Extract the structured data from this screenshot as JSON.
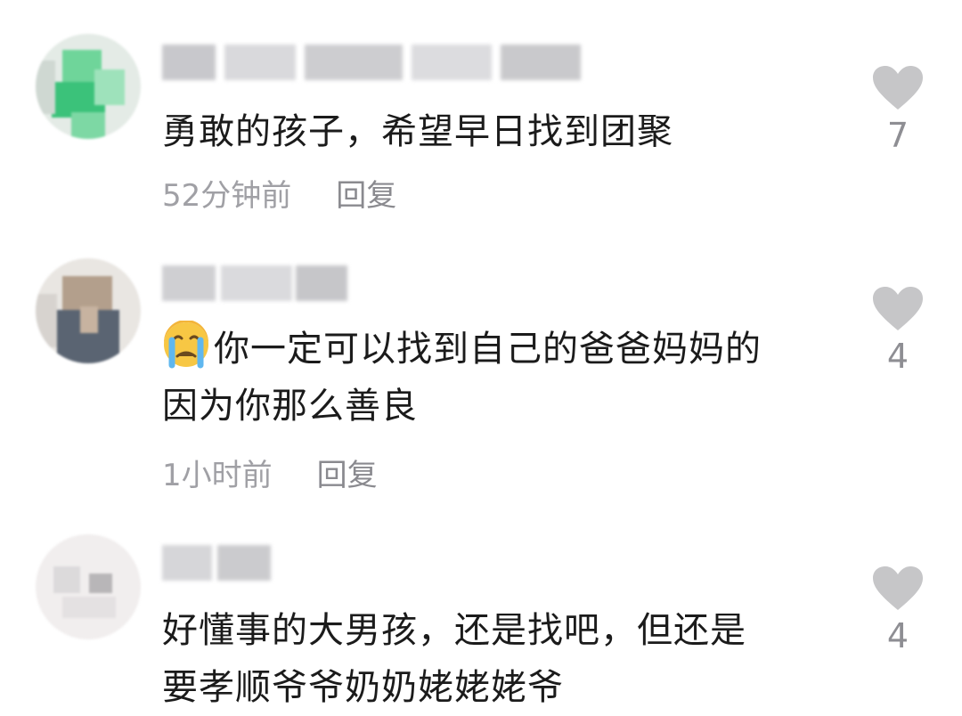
{
  "comments": [
    {
      "text": "勇敢的孩子，希望早日找到团聚",
      "time": "52分钟前",
      "reply": "回复",
      "likes": "7",
      "avatar_icon": "blurred-avatar",
      "emoji": ""
    },
    {
      "text": "你一定可以找到自己的爸爸妈妈的\n因为你那么善良",
      "time": "1小时前",
      "reply": "回复",
      "likes": "4",
      "avatar_icon": "blurred-avatar",
      "emoji": "crying-face-emoji"
    },
    {
      "text": "好懂事的大男孩，还是找吧，但还是\n要孝顺爷爷奶奶姥姥姥爷",
      "time": "",
      "reply": "",
      "likes": "4",
      "avatar_icon": "blurred-avatar",
      "emoji": ""
    }
  ],
  "colors": {
    "heart": "#c6c6c8",
    "meta_text": "#a0a0a5",
    "comment_text": "#1b1b1b"
  }
}
